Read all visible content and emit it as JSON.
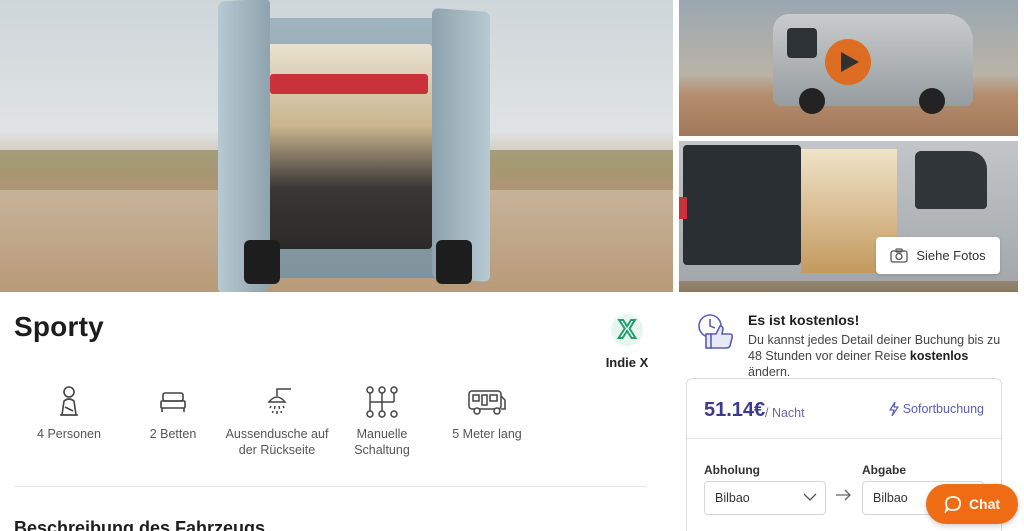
{
  "vehicle": {
    "name": "Sporty",
    "brand": "Indie X",
    "brand_logo_letter": "X"
  },
  "gallery": {
    "see_photos_label": "Siehe Fotos"
  },
  "features": [
    {
      "icon": "seat-icon",
      "label_line1": "4 Personen",
      "label_line2": ""
    },
    {
      "icon": "bed-icon",
      "label_line1": "2 Betten",
      "label_line2": ""
    },
    {
      "icon": "shower-icon",
      "label_line1": "Aussendusche auf",
      "label_line2": "der Rückseite"
    },
    {
      "icon": "gearshift-icon",
      "label_line1": "Manuelle",
      "label_line2": "Schaltung"
    },
    {
      "icon": "van-icon",
      "label_line1": "5 Meter lang",
      "label_line2": ""
    }
  ],
  "description": {
    "section_title": "Beschreibung des Fahrzeugs"
  },
  "free_change": {
    "title": "Es ist kostenlos!",
    "text_before": "Du kannst jedes Detail deiner Buchung bis zu 48 Stunden vor deiner Reise",
    "text_bold": "kostenlos",
    "text_after": "ändern."
  },
  "booking": {
    "price": "51.14€",
    "per_unit": "/ Nacht",
    "instant_label": "Sofortbuchung",
    "pickup_label": "Abholung",
    "pickup_value": "Bilbao",
    "dropoff_label": "Abgabe",
    "dropoff_value": "Bilbao"
  },
  "chat": {
    "label": "Chat"
  },
  "colors": {
    "accent_orange": "#ef6c14",
    "price_purple": "#3b3a8f",
    "brand_green": "#22a06b"
  }
}
